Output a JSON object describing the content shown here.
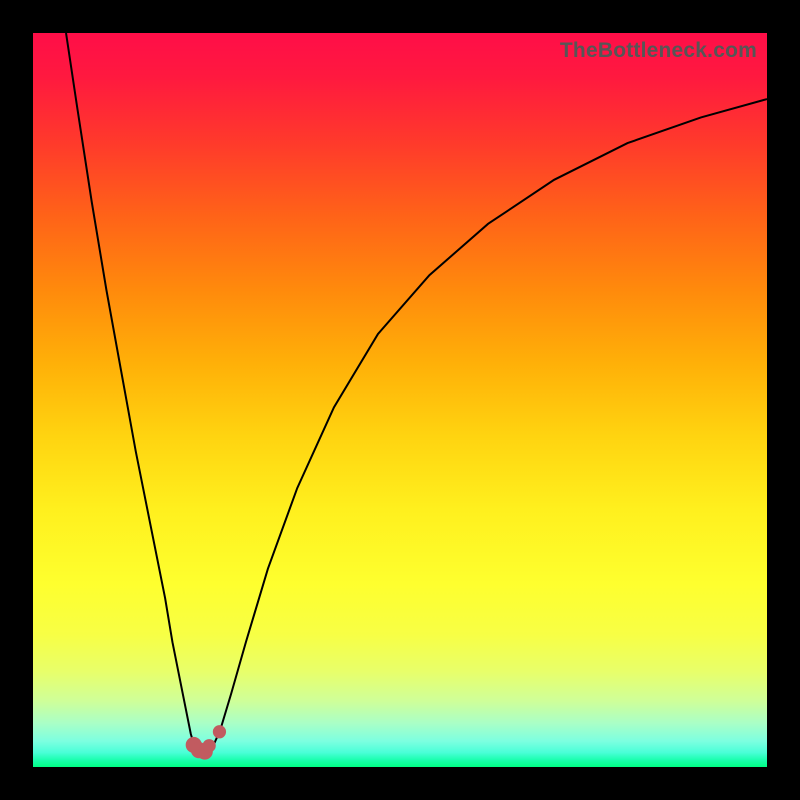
{
  "watermark": "TheBottleneck.com",
  "colors": {
    "frame": "#000000",
    "curve": "#000000",
    "dots": "#c15b60",
    "gradient_top": "#ff0e48",
    "gradient_bottom": "#00ff85"
  },
  "chart_data": {
    "type": "line",
    "title": "",
    "xlabel": "",
    "ylabel": "",
    "xlim": [
      0,
      100
    ],
    "ylim": [
      0,
      100
    ],
    "series": [
      {
        "name": "left-branch",
        "x": [
          4.5,
          6,
          8,
          10,
          12,
          14,
          16,
          18,
          19,
          20,
          20.8,
          21.5,
          22.0,
          22.4
        ],
        "values": [
          100,
          90,
          77,
          65,
          54,
          43,
          33,
          23,
          17,
          12,
          8,
          4.5,
          2.8,
          2.3
        ]
      },
      {
        "name": "right-branch",
        "x": [
          24.0,
          24.6,
          25.5,
          27,
          29,
          32,
          36,
          41,
          47,
          54,
          62,
          71,
          81,
          91,
          100
        ],
        "values": [
          2.3,
          3.0,
          5.0,
          10,
          17,
          27,
          38,
          49,
          59,
          67,
          74,
          80,
          85,
          88.5,
          91
        ]
      }
    ],
    "markers": [
      {
        "x": 21.9,
        "y": 3.0,
        "r": 1.1
      },
      {
        "x": 22.6,
        "y": 2.3,
        "r": 1.1
      },
      {
        "x": 23.4,
        "y": 2.1,
        "r": 1.1
      },
      {
        "x": 23.5,
        "y": 2.3,
        "r": 0.9
      },
      {
        "x": 24.0,
        "y": 2.9,
        "r": 0.9
      },
      {
        "x": 25.4,
        "y": 4.8,
        "r": 0.9
      }
    ]
  }
}
